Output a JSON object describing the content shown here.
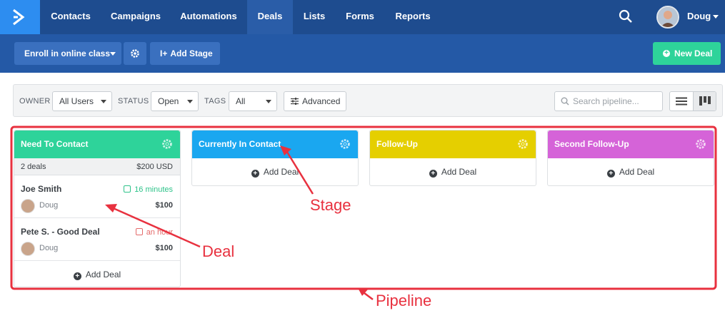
{
  "nav": {
    "items": [
      {
        "label": "Contacts"
      },
      {
        "label": "Campaigns"
      },
      {
        "label": "Automations"
      },
      {
        "label": "Deals"
      },
      {
        "label": "Lists"
      },
      {
        "label": "Forms"
      },
      {
        "label": "Reports"
      }
    ],
    "active": "Deals",
    "user_name": "Doug",
    "logo_icon": "chevron-right-icon",
    "search_icon": "search-icon"
  },
  "toolbar": {
    "pipeline_select": "Enroll in online class",
    "settings_icon": "gear-icon",
    "add_stage": "Add Stage",
    "new_deal": "New Deal"
  },
  "filters": {
    "owner_label": "OWNER",
    "owner_value": "All Users",
    "status_label": "STATUS",
    "status_value": "Open",
    "tags_label": "TAGS",
    "tags_value": "All",
    "advanced": "Advanced",
    "search_placeholder": "Search pipeline...",
    "view_list_icon": "list-view-icon",
    "view_board_icon": "board-view-icon"
  },
  "stages": [
    {
      "name": "Need To Contact",
      "color": "#2ed39a",
      "summary_count": "2 deals",
      "summary_value": "$200 USD",
      "deals": [
        {
          "title": "Joe Smith",
          "owner": "Doug",
          "value": "$100",
          "time": "16 minutes",
          "time_color": "#2ec38a"
        },
        {
          "title": "Pete S. - Good Deal",
          "owner": "Doug",
          "value": "$100",
          "time": "an hour",
          "time_color": "#e46a6a"
        }
      ],
      "add_deal": "Add Deal"
    },
    {
      "name": "Currently In Contact",
      "color": "#1aa7f0",
      "add_deal": "Add Deal"
    },
    {
      "name": "Follow-Up",
      "color": "#e5cf00",
      "add_deal": "Add Deal"
    },
    {
      "name": "Second Follow-Up",
      "color": "#d563d8",
      "add_deal": "Add Deal"
    }
  ],
  "annotations": {
    "stage": "Stage",
    "deal": "Deal",
    "pipeline": "Pipeline",
    "color": "#e8313f"
  }
}
